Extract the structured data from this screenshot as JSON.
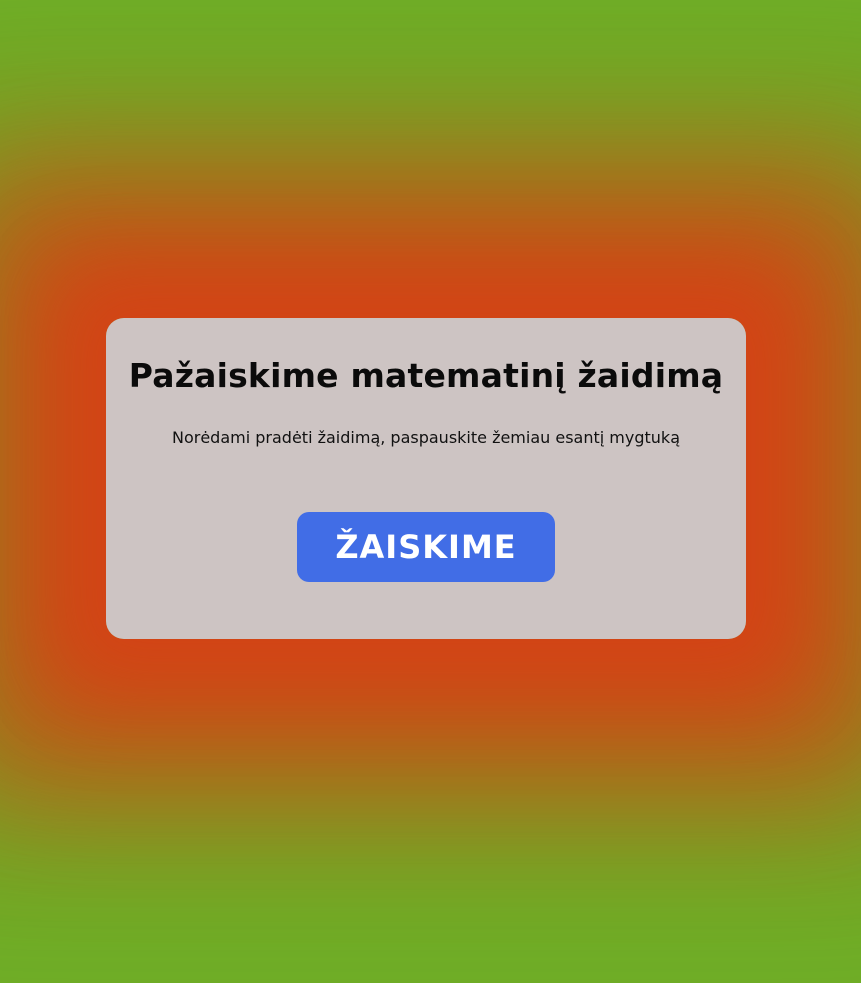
{
  "modal": {
    "title": "Pažaiskime matematinį žaidimą",
    "instruction": "Norėdami pradėti žaidimą, paspauskite žemiau esantį mygtuką",
    "play_button_label": "ŽAISKIME"
  },
  "colors": {
    "background": "#6fae27",
    "glow": "#d34416",
    "modal": "#cdc4c3",
    "button": "#416de6"
  }
}
